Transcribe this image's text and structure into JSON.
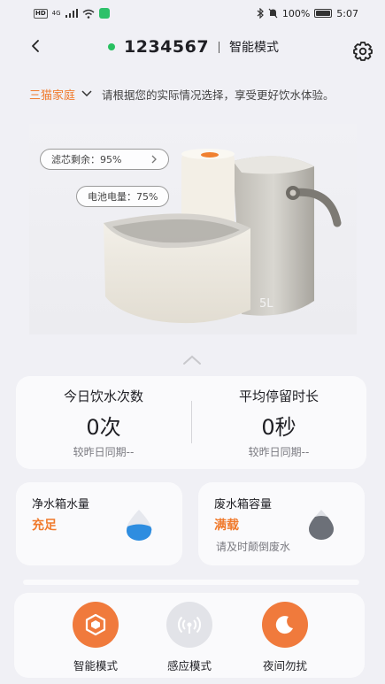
{
  "status_bar": {
    "hd": "HD",
    "network": "4G",
    "battery_percent": "100%",
    "time": "5:07"
  },
  "header": {
    "device_id": "1234567",
    "mode_title": "智能模式"
  },
  "family": {
    "name": "三猫家庭",
    "tip": "请根据您的实际情况选择，享受更好饮水体验。"
  },
  "product": {
    "filter_label": "滤芯剩余：95%",
    "battery_label": "电池电量：75%",
    "capacity_mark": "5L"
  },
  "stats": {
    "drink_count": {
      "label": "今日饮水次数",
      "value": "0次",
      "compare": "较昨日同期--"
    },
    "avg_stay": {
      "label": "平均停留时长",
      "value": "0秒",
      "compare": "较昨日同期--"
    }
  },
  "tanks": {
    "clean": {
      "title": "净水箱水量",
      "status": "充足"
    },
    "waste": {
      "title": "废水箱容量",
      "status": "满载",
      "hint": "请及时颠倒废水"
    }
  },
  "modes": [
    {
      "label": "智能模式",
      "icon": "hexagon-icon",
      "active": true
    },
    {
      "label": "感应模式",
      "icon": "sensor-icon",
      "active": false
    },
    {
      "label": "夜间勿扰",
      "icon": "moon-icon",
      "active": true
    }
  ],
  "colors": {
    "accent": "#f07a2c",
    "online": "#28c060",
    "clean_water": "#2e8de0",
    "waste_water": "#6c7078"
  }
}
